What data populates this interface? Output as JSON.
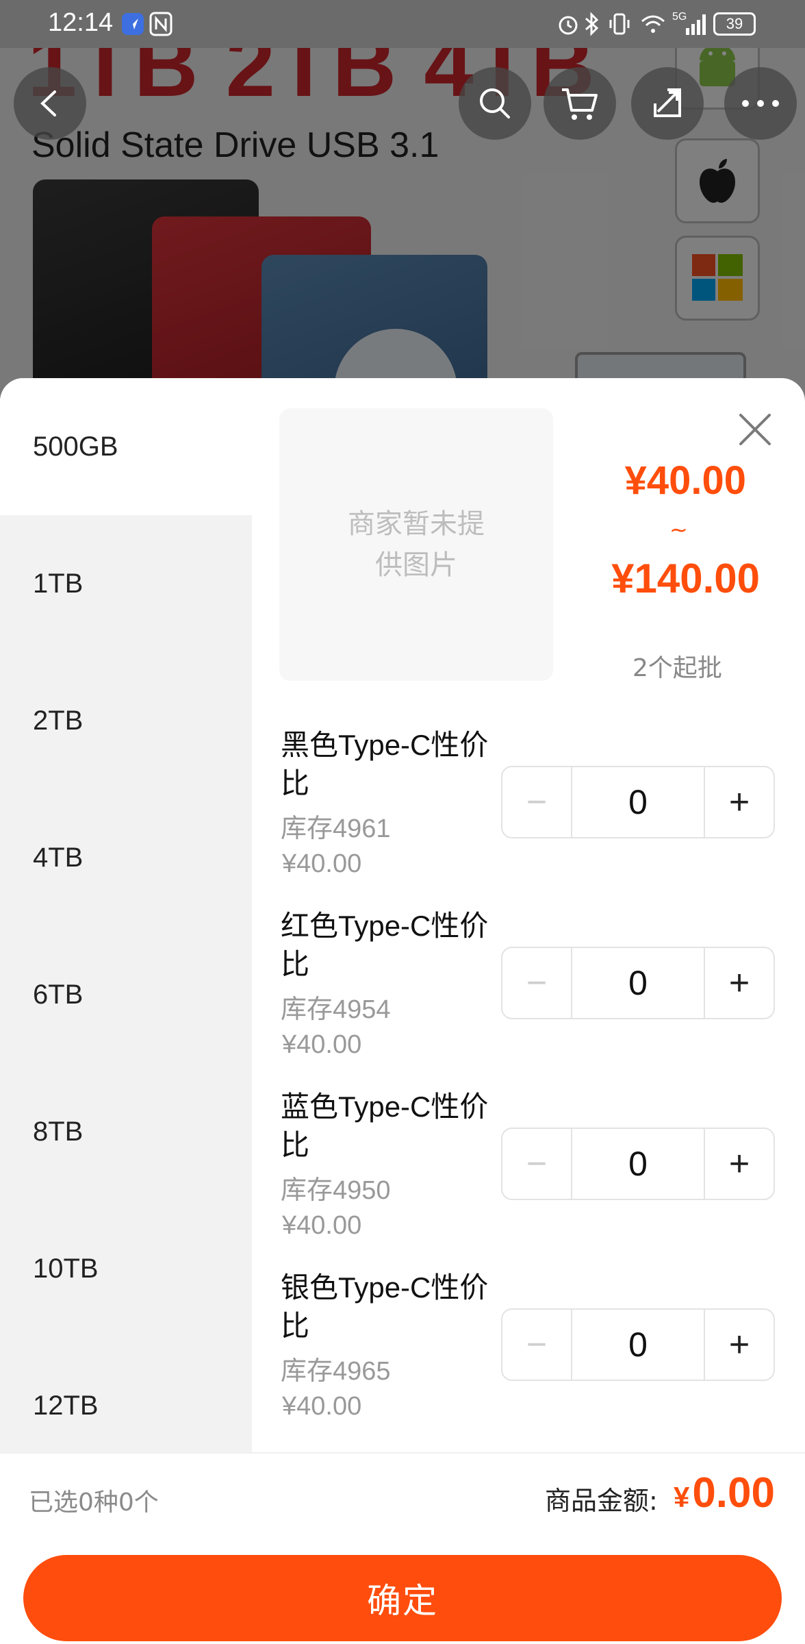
{
  "status_bar": {
    "time": "12:14",
    "network": "5G",
    "battery": "39"
  },
  "hero": {
    "headline": "1TB 2TB 4TB",
    "subtitle": "Solid State Drive USB 3.1"
  },
  "top_actions": {
    "back": "back-arrow-icon",
    "search": "search-icon",
    "cart": "cart-icon",
    "share": "share-icon",
    "more": "more-icon"
  },
  "sheet": {
    "capacities": [
      "500GB",
      "1TB",
      "2TB",
      "4TB",
      "6TB",
      "8TB",
      "10TB",
      "12TB"
    ],
    "selected_capacity": "500GB",
    "thumbnail_placeholder": "商家暂未提供图片",
    "price_low": "¥40.00",
    "price_separator": "~",
    "price_high": "¥140.00",
    "min_order": "2个起批",
    "variants": [
      {
        "name": "黑色Type-C性价比",
        "stock": "库存4961",
        "price": "¥40.00",
        "qty": "0"
      },
      {
        "name": "红色Type-C性价比",
        "stock": "库存4954",
        "price": "¥40.00",
        "qty": "0"
      },
      {
        "name": "蓝色Type-C性价比",
        "stock": "库存4950",
        "price": "¥40.00",
        "qty": "0"
      },
      {
        "name": "银色Type-C性价比",
        "stock": "库存4965",
        "price": "¥40.00",
        "qty": "0"
      }
    ],
    "stepper_minus": "−",
    "stepper_plus": "+"
  },
  "footer": {
    "selected_info": "已选0种0个",
    "total_label": "商品金额:",
    "total_currency": "¥",
    "total_value": "0.00",
    "confirm_label": "确定"
  },
  "colors": {
    "accent": "#ff4d0d",
    "price": "#ff4e0c"
  }
}
